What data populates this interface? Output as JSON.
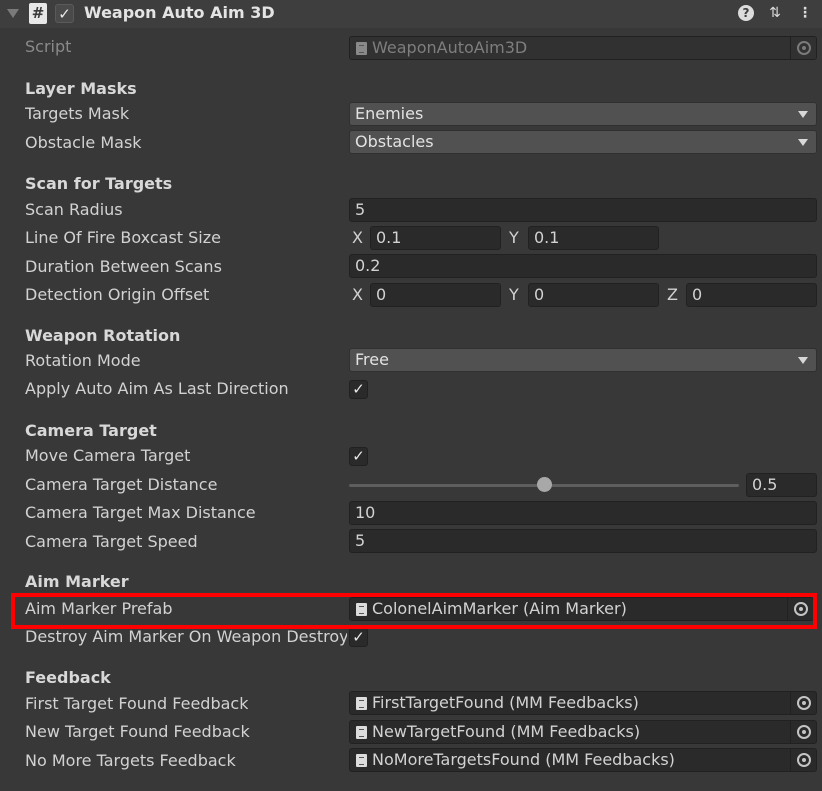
{
  "header": {
    "title": "Weapon Auto Aim 3D",
    "enabled": true,
    "script_icon": "#",
    "check_glyph": "✓"
  },
  "script": {
    "label": "Script",
    "value": "WeaponAutoAim3D"
  },
  "layer_masks": {
    "section": "Layer Masks",
    "targets_mask": {
      "label": "Targets Mask",
      "value": "Enemies"
    },
    "obstacle_mask": {
      "label": "Obstacle Mask",
      "value": "Obstacles"
    }
  },
  "scan": {
    "section": "Scan for Targets",
    "scan_radius": {
      "label": "Scan Radius",
      "value": "5"
    },
    "boxcast": {
      "label": "Line Of Fire Boxcast Size",
      "x_label": "X",
      "x": "0.1",
      "y_label": "Y",
      "y": "0.1"
    },
    "duration": {
      "label": "Duration Between Scans",
      "value": "0.2"
    },
    "origin": {
      "label": "Detection Origin Offset",
      "x_label": "X",
      "x": "0",
      "y_label": "Y",
      "y": "0",
      "z_label": "Z",
      "z": "0"
    }
  },
  "rotation": {
    "section": "Weapon Rotation",
    "mode": {
      "label": "Rotation Mode",
      "value": "Free"
    },
    "apply_last": {
      "label": "Apply Auto Aim As Last Direction",
      "checked": true
    }
  },
  "camera": {
    "section": "Camera Target",
    "move": {
      "label": "Move Camera Target",
      "checked": true
    },
    "distance": {
      "label": "Camera Target Distance",
      "value": "0.5",
      "fraction": 0.5
    },
    "max_distance": {
      "label": "Camera Target Max Distance",
      "value": "10"
    },
    "speed": {
      "label": "Camera Target Speed",
      "value": "5"
    }
  },
  "aim_marker": {
    "section": "Aim Marker",
    "prefab": {
      "label": "Aim Marker Prefab",
      "value": "ColonelAimMarker (Aim Marker)"
    },
    "destroy": {
      "label": "Destroy Aim Marker On Weapon Destroy",
      "checked": true
    }
  },
  "feedback": {
    "section": "Feedback",
    "first": {
      "label": "First Target Found Feedback",
      "value": "FirstTargetFound (MM Feedbacks)"
    },
    "new": {
      "label": "New Target Found Feedback",
      "value": "NewTargetFound (MM Feedbacks)"
    },
    "none": {
      "label": "No More Targets Feedback",
      "value": "NoMoreTargetsFound (MM Feedbacks)"
    }
  },
  "icons": {
    "help": "?",
    "preset": "⇅",
    "menu": "⋮"
  },
  "colors": {
    "background": "#383838",
    "highlight": "#ff0000"
  }
}
